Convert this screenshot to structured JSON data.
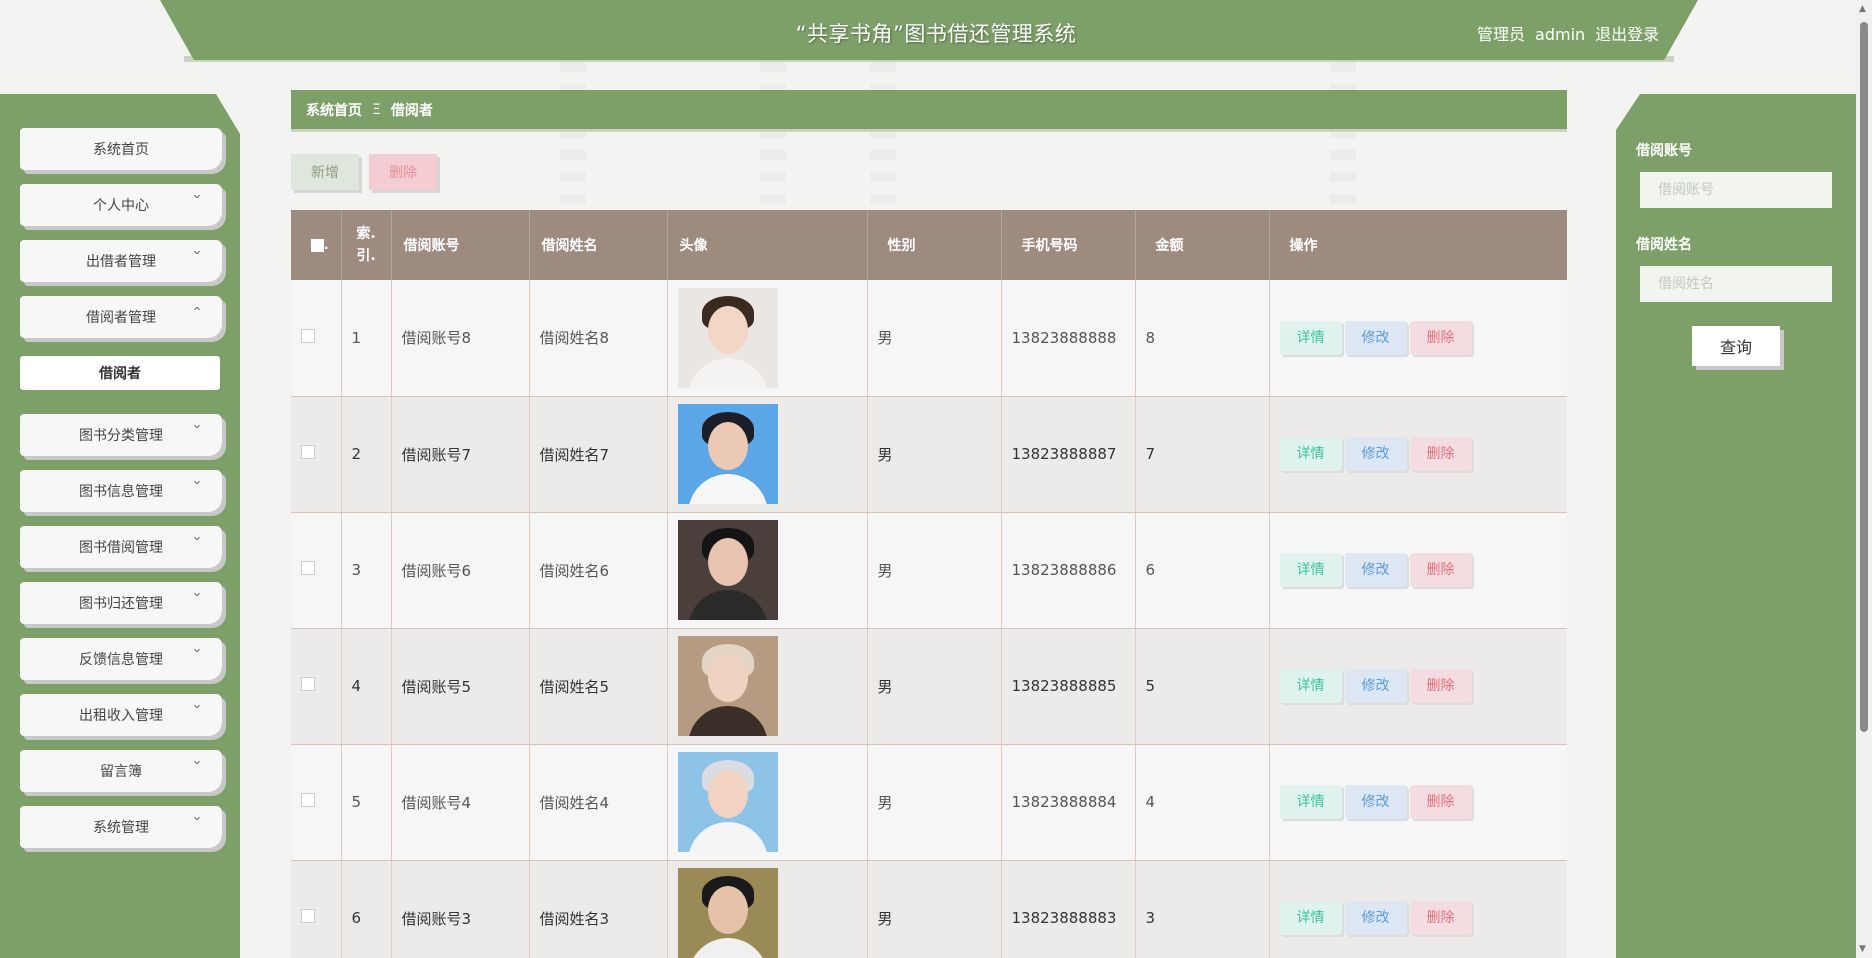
{
  "header": {
    "title": "“共享书角”图书借还管理系统",
    "role": "管理员",
    "username": "admin",
    "logout": "退出登录"
  },
  "sidebar": {
    "items": [
      {
        "label": "系统首页",
        "expandable": false
      },
      {
        "label": "个人中心",
        "expandable": true
      },
      {
        "label": "出借者管理",
        "expandable": true
      },
      {
        "label": "借阅者管理",
        "expandable": true,
        "expanded": true
      },
      {
        "label": "图书分类管理",
        "expandable": true
      },
      {
        "label": "图书信息管理",
        "expandable": true
      },
      {
        "label": "图书借阅管理",
        "expandable": true
      },
      {
        "label": "图书归还管理",
        "expandable": true
      },
      {
        "label": "反馈信息管理",
        "expandable": true
      },
      {
        "label": "出租收入管理",
        "expandable": true
      },
      {
        "label": "留言簿",
        "expandable": true
      },
      {
        "label": "系统管理",
        "expandable": true
      }
    ],
    "active_subitem": "借阅者"
  },
  "breadcrumb": {
    "home": "系统首页",
    "separator": "Ξ",
    "current": "借阅者"
  },
  "toolbar": {
    "add_label": "新增",
    "delete_label": "删除"
  },
  "table": {
    "columns": [
      "索.\n引.",
      "借阅账号",
      "借阅姓名",
      "头像",
      "性别",
      "手机号码",
      "金额",
      "操作"
    ],
    "rows": [
      {
        "index": "1",
        "account": "借阅账号8",
        "name": "借阅姓名8",
        "gender": "男",
        "phone": "13823888888",
        "amount": "8"
      },
      {
        "index": "2",
        "account": "借阅账号7",
        "name": "借阅姓名7",
        "gender": "男",
        "phone": "13823888887",
        "amount": "7"
      },
      {
        "index": "3",
        "account": "借阅账号6",
        "name": "借阅姓名6",
        "gender": "男",
        "phone": "13823888886",
        "amount": "6"
      },
      {
        "index": "4",
        "account": "借阅账号5",
        "name": "借阅姓名5",
        "gender": "男",
        "phone": "13823888885",
        "amount": "5"
      },
      {
        "index": "5",
        "account": "借阅账号4",
        "name": "借阅姓名4",
        "gender": "男",
        "phone": "13823888884",
        "amount": "4"
      },
      {
        "index": "6",
        "account": "借阅账号3",
        "name": "借阅姓名3",
        "gender": "男",
        "phone": "13823888883",
        "amount": "3"
      }
    ],
    "actions": {
      "detail": "详情",
      "edit": "修改",
      "delete": "删除"
    }
  },
  "search": {
    "account_label": "借阅账号",
    "account_placeholder": "借阅账号",
    "name_label": "借阅姓名",
    "name_placeholder": "借阅姓名",
    "query_label": "查询"
  },
  "colors": {
    "primary_green": "#7da068",
    "table_header": "#9e8b80",
    "detail": "#3fc3a0",
    "edit": "#5c9bd8",
    "delete": "#e46e7b"
  }
}
